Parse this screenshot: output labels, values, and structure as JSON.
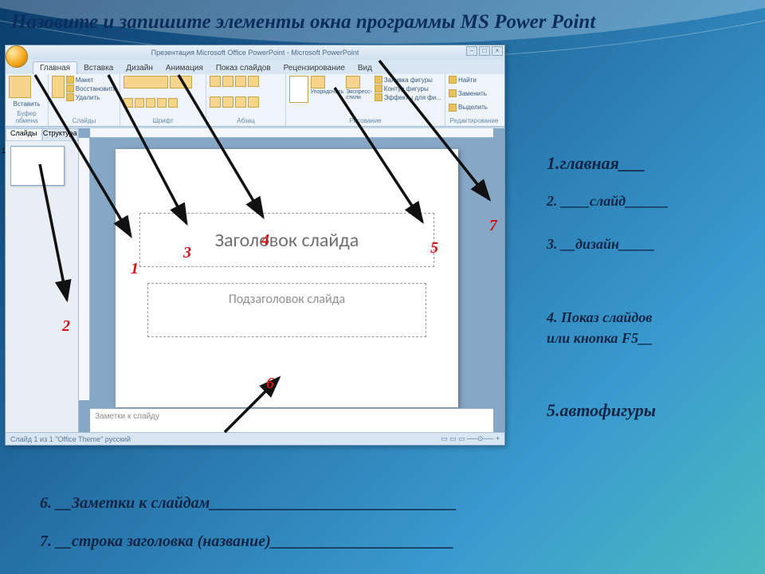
{
  "title": "Назовите и запишите элементы окна программы MS Power Point",
  "pp": {
    "titlebar": "Презентация Microsoft Office PowerPoint - Microsoft PowerPoint",
    "tabs": [
      "Главная",
      "Вставка",
      "Дизайн",
      "Анимация",
      "Показ слайдов",
      "Рецензирование",
      "Вид"
    ],
    "ribbon_groups": {
      "clipboard": "Буфер обмена",
      "slides": "Слайды",
      "font": "Шрифт",
      "paragraph": "Абзац",
      "drawing": "Рисование",
      "editing": "Редактирование"
    },
    "ribbon_items": {
      "paste": "Вставить",
      "new_slide": "Создать слайд",
      "layout": "Макет",
      "reset": "Восстановить",
      "delete": "Удалить",
      "arrange": "Упорядочить",
      "quick_styles": "Экспресс-стили",
      "shape_fill": "Заливка фигуры",
      "shape_outline": "Контур фигуры",
      "shape_effects": "Эффекты для фи...",
      "find": "Найти",
      "replace": "Заменить",
      "select": "Выделить"
    },
    "sidepane_tabs": [
      "Слайды",
      "Структура"
    ],
    "title_placeholder": "Заголовок слайда",
    "subtitle_placeholder": "Подзаголовок слайда",
    "notes_placeholder": "Заметки к слайду",
    "status_left": "Слайд 1 из 1    \"Office Theme\"    русский"
  },
  "numbers": {
    "n1": "1",
    "n2": "2",
    "n3": "3",
    "n4": "4",
    "n5": "5",
    "n6": "6",
    "n7": "7"
  },
  "answers": {
    "a1_idx": "1.",
    "a1_txt": "главная___",
    "a2_idx": "2.",
    "a2_txt": "____слайд______",
    "a3_idx": "3.",
    "a3_txt": "__дизайн_____",
    "a4_idx": "4.",
    "a4_txt": "Показ слайдов",
    "a4b_txt": "или кнопка F5__",
    "a5_idx": "5.",
    "a5_txt": "автофигуры",
    "a6_idx": "6.",
    "a6_txt": "__Заметки к слайдам_______________________________",
    "a7_idx": "7.",
    "a7_txt": "__строка заголовка (название)_______________________"
  }
}
